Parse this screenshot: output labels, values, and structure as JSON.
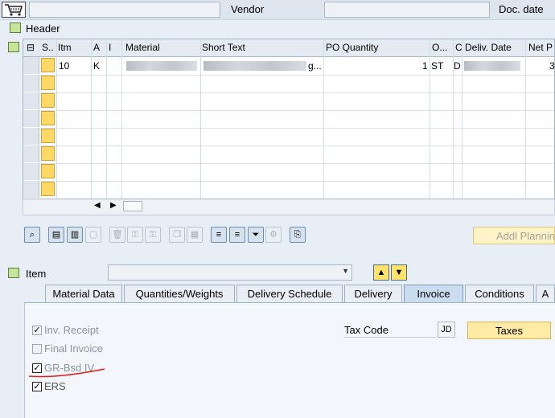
{
  "header_bar": {
    "vendor_label": "Vendor",
    "doc_date_label": "Doc. date"
  },
  "header_section": {
    "label": "Header"
  },
  "item_table": {
    "columns": [
      "S..",
      "Itm",
      "A",
      "I",
      "Material",
      "Short Text",
      "PO Quantity",
      "O...",
      "C",
      "Deliv. Date",
      "Net P"
    ],
    "rows": [
      {
        "itm": "10",
        "a": "K",
        "short_text_suffix": "g...",
        "po_quantity": "1",
        "order_unit": "ST",
        "c": "D",
        "net_price": "3"
      }
    ]
  },
  "toolbar": {
    "addl_planning_label": "Addl Planning"
  },
  "item_section": {
    "label": "Item"
  },
  "tabs": [
    {
      "label": "Material Data",
      "active": false
    },
    {
      "label": "Quantities/Weights",
      "active": false
    },
    {
      "label": "Delivery Schedule",
      "active": false
    },
    {
      "label": "Delivery",
      "active": false
    },
    {
      "label": "Invoice",
      "active": true
    },
    {
      "label": "Conditions",
      "active": false
    },
    {
      "label": "A",
      "active": false
    }
  ],
  "invoice_tab": {
    "checkboxes": [
      {
        "label": "Inv. Receipt",
        "checked": true
      },
      {
        "label": "Final Invoice",
        "checked": false
      },
      {
        "label": "GR-Bsd IV",
        "checked": true
      },
      {
        "label": "ERS",
        "checked": true
      }
    ],
    "tax_code_label": "Tax Code",
    "tax_code_value": "JD",
    "taxes_button": "Taxes"
  },
  "colors": {
    "annotation_underline": "#e0201b",
    "active_tab": "#c9dcf0",
    "yellow_cell": "#ffd866"
  }
}
